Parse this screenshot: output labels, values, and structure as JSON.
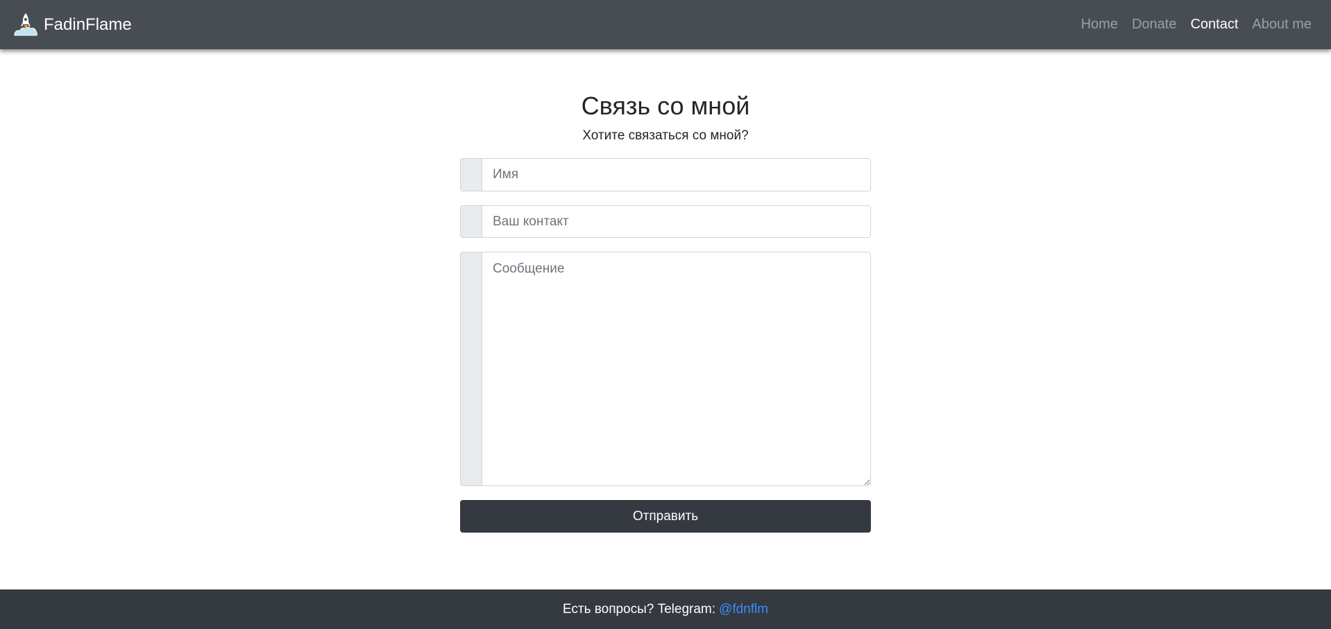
{
  "navbar": {
    "brand": "FadinFlame",
    "links": [
      {
        "label": "Home",
        "active": false
      },
      {
        "label": "Donate",
        "active": false
      },
      {
        "label": "Contact",
        "active": true
      },
      {
        "label": "About me",
        "active": false
      }
    ],
    "colors": {
      "background": "#484d54",
      "active": "#ffffff",
      "inactive": "#9ba0a6"
    }
  },
  "main": {
    "title": "Связь со мной",
    "subtitle": "Хотите связаться со мной?",
    "form": {
      "name_placeholder": "Имя",
      "contact_placeholder": "Ваш контакт",
      "message_placeholder": "Сообщение",
      "submit_label": "Отправить"
    }
  },
  "footer": {
    "text": "Есть вопросы? Telegram:",
    "link_label": "@fdnflm",
    "colors": {
      "background": "#343a40",
      "link": "#3d8bfd"
    }
  },
  "icons": {
    "brand": "rocket-logo-icon"
  }
}
